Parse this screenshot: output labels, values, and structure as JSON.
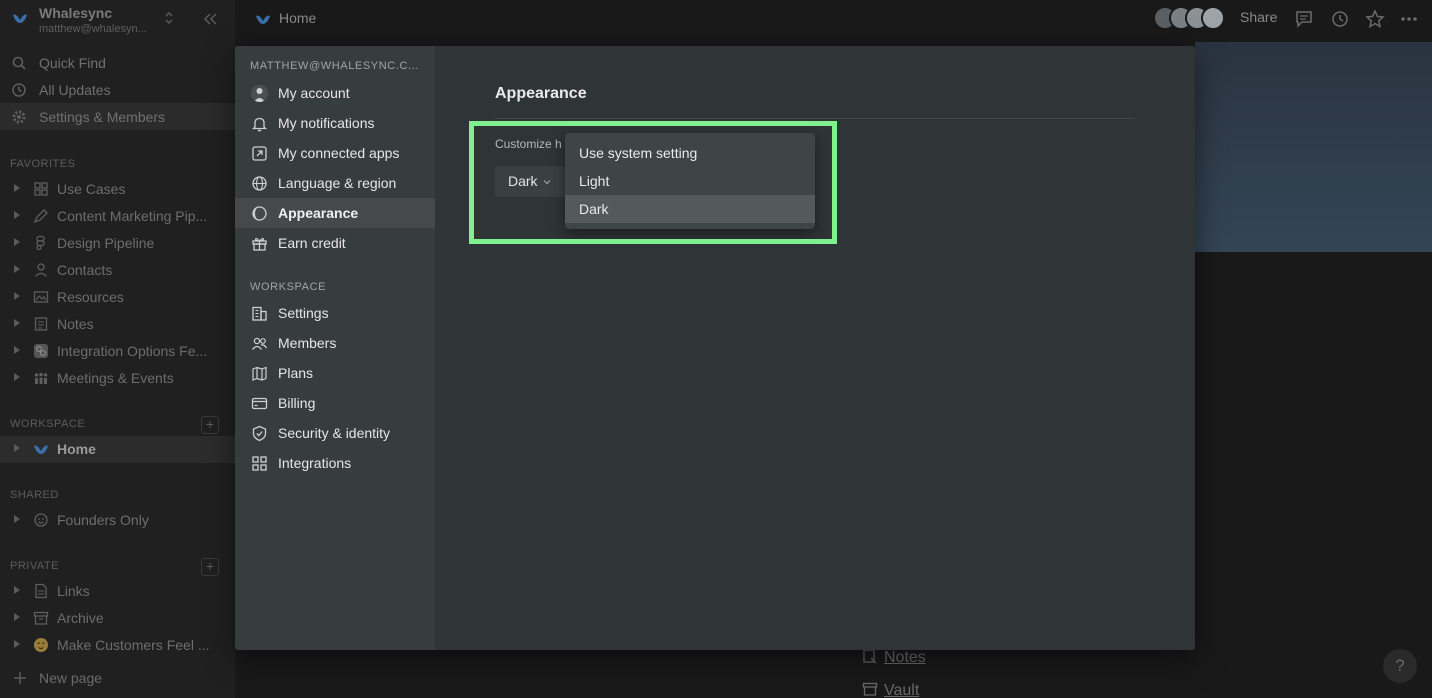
{
  "workspace": {
    "name": "Whalesync",
    "email": "matthew@whalesyn..."
  },
  "sidebar": {
    "top_items": [
      {
        "label": "Quick Find",
        "icon": "search-icon"
      },
      {
        "label": "All Updates",
        "icon": "clock-icon"
      },
      {
        "label": "Settings & Members",
        "icon": "gear-icon"
      }
    ],
    "favorites_label": "FAVORITES",
    "favorites": [
      {
        "label": "Use Cases",
        "icon": "grid-icon"
      },
      {
        "label": "Content Marketing Pip...",
        "icon": "pen-icon"
      },
      {
        "label": "Design Pipeline",
        "icon": "figma-icon"
      },
      {
        "label": "Contacts",
        "icon": "person-icon"
      },
      {
        "label": "Resources",
        "icon": "image-icon"
      },
      {
        "label": "Notes",
        "icon": "note-icon"
      },
      {
        "label": "Integration Options Fe...",
        "icon": "integration-icon"
      },
      {
        "label": "Meetings & Events",
        "icon": "people-icon"
      }
    ],
    "workspace_label": "WORKSPACE",
    "workspace_items": [
      {
        "label": "Home",
        "icon": "whale-icon"
      }
    ],
    "shared_label": "SHARED",
    "shared_items": [
      {
        "label": "Founders Only",
        "icon": "smiley-icon"
      }
    ],
    "private_label": "PRIVATE",
    "private_items": [
      {
        "label": "Links",
        "icon": "page-icon"
      },
      {
        "label": "Archive",
        "icon": "archive-icon"
      },
      {
        "label": "Make Customers Feel ...",
        "icon": "emoji-icon"
      }
    ],
    "new_page_label": "New page"
  },
  "topbar": {
    "breadcrumb": "Home",
    "share_label": "Share"
  },
  "page": {
    "links": [
      "Notes",
      "Vault"
    ],
    "help_label": "?"
  },
  "settings_modal": {
    "account_label": "MATTHEW@WHALESYNC.C...",
    "account_items": [
      {
        "label": "My account",
        "icon": "avatar-icon"
      },
      {
        "label": "My notifications",
        "icon": "bell-icon"
      },
      {
        "label": "My connected apps",
        "icon": "external-link-icon"
      },
      {
        "label": "Language & region",
        "icon": "globe-icon"
      },
      {
        "label": "Appearance",
        "icon": "moon-icon",
        "active": true
      },
      {
        "label": "Earn credit",
        "icon": "gift-icon"
      }
    ],
    "workspace_label": "WORKSPACE",
    "workspace_items": [
      {
        "label": "Settings",
        "icon": "building-icon"
      },
      {
        "label": "Members",
        "icon": "members-icon"
      },
      {
        "label": "Plans",
        "icon": "map-icon"
      },
      {
        "label": "Billing",
        "icon": "credit-card-icon"
      },
      {
        "label": "Security & identity",
        "icon": "shield-icon"
      },
      {
        "label": "Integrations",
        "icon": "grid-icon"
      }
    ],
    "title": "Appearance",
    "customize_label": "Customize h",
    "theme_value": "Dark",
    "theme_options": [
      "Use system setting",
      "Light",
      "Dark"
    ],
    "selected_option": "Dark"
  },
  "colors": {
    "highlight": "#7ef08f",
    "modal_bg": "#2f3437",
    "modal_sidebar": "#373c3f"
  }
}
